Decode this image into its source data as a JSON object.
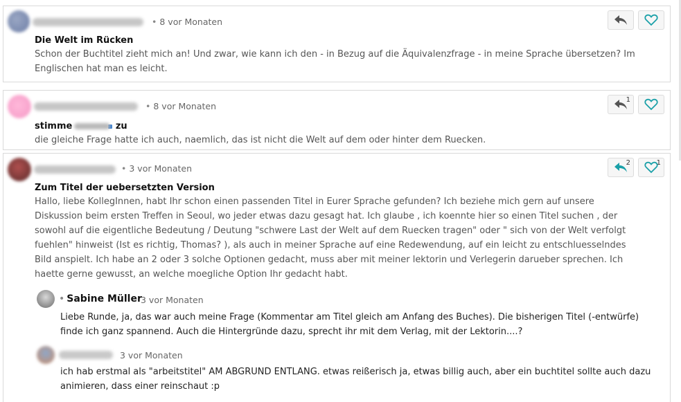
{
  "comments": [
    {
      "time": "8 vor Monaten",
      "title": "Die Welt im Rücken",
      "body": "Schon der Buchtitel zieht mich an! Und zwar, wie kann ich den - in Bezug auf die Äquivalenzfrage - in meine Sprache übersetzen? Im Englischen hat man es leicht.",
      "reply_count": "",
      "like_count": ""
    },
    {
      "time": "8 vor Monaten",
      "title_prefix": "stimme",
      "title_suffix": "zu",
      "body": "die gleiche Frage hatte ich auch, naemlich, das ist nicht die Welt auf dem oder hinter dem Ruecken.",
      "reply_count": "1",
      "like_count": ""
    },
    {
      "time": "3 vor Monaten",
      "title": "Zum Titel der uebersetzten Version",
      "body": "Hallo, liebe KollegInnen, habt Ihr schon einen passenden Titel in Eurer Sprache gefunden? Ich beziehe mich gern auf unsere Diskussion beim ersten Treffen in Seoul, wo jeder etwas dazu gesagt hat. Ich glaube , ich koennte hier so einen Titel suchen , der sowohl auf die eigentliche Bedeutung / Deutung \"schwere Last der Welt auf dem Ruecken tragen\" oder \" sich von der Welt verfolgt fuehlen\" hinweist (Ist es richtig, Thomas? ), als auch in meiner Sprache auf eine Redewendung, auf ein leicht zu entschluesselndes Bild anspielt. Ich habe an 2 oder 3 solche Optionen gedacht, muss aber mit meiner lektorin und Verlegerin darueber sprechen. Ich haette gerne gewusst, an welche moegliche Option Ihr gedacht habt.",
      "reply_count": "2",
      "like_count": "1",
      "replies": [
        {
          "name": "Sabine Müller",
          "time": "3 vor Monaten",
          "body": "Liebe Runde, ja, das war auch meine Frage (Kommentar am Titel gleich am Anfang des Buches). Die bisherigen Titel (-entwürfe) finde ich ganz spannend. Auch die Hintergründe dazu, sprecht ihr mit dem Verlag, mit der Lektorin....?"
        },
        {
          "name": "",
          "time": "3 vor Monaten",
          "body": "ich hab erstmal als \"arbeitstitel\" AM ABGRUND ENTLANG. etwas reißerisch ja, etwas billig auch, aber ein buchtitel sollte auch dazu animieren, dass einer reinschaut :p"
        }
      ]
    }
  ],
  "icons": {
    "reply": "reply-arrow-icon",
    "like": "heart-icon"
  },
  "colors": {
    "accent": "#1aa0a8",
    "icon_gray": "#555555",
    "meta_gray": "#666666",
    "body_gray": "#555555"
  }
}
